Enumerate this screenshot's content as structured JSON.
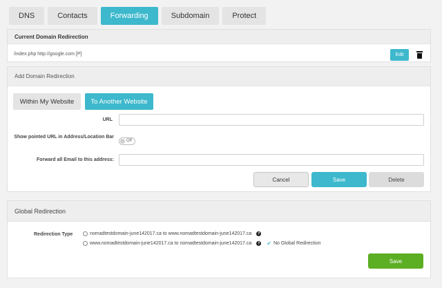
{
  "tabs": [
    {
      "label": "DNS",
      "active": false
    },
    {
      "label": "Contacts",
      "active": false
    },
    {
      "label": "Forwarding",
      "active": true
    },
    {
      "label": "Subdomain",
      "active": false
    },
    {
      "label": "Protect",
      "active": false
    }
  ],
  "current_redirection": {
    "title": "Current Domain Redirection",
    "entry": "/index.php http://google.com [P]",
    "edit_label": "Edit",
    "delete_icon": "trash-icon"
  },
  "add_redirection": {
    "title": "Add Domain Redirection",
    "mode_within": "Within My Website",
    "mode_another": "To Another Website",
    "active_mode": "To Another Website",
    "url_label": "URL",
    "url_value": "",
    "show_url_label": "Show pointed URL in Address/Location Bar",
    "show_url_toggle": "Off",
    "forward_email_label": "Forward all Email to this address:",
    "forward_email_value": "",
    "cancel_label": "Cancel",
    "save_label": "Save",
    "delete_label": "Delete"
  },
  "global_redirection": {
    "title": "Global Redirection",
    "type_label": "Redirection Type",
    "options": [
      "nomadtestdomain-june142017.ca to www.nomadtestdomain-june142017.ca",
      "www.nomadtestdomain-june142017.ca to nomadtestdomain-june142017.ca"
    ],
    "current_status": "No Global Redirection",
    "save_label": "Save"
  },
  "colors": {
    "accent": "#3db8cc",
    "save_green": "#5cae22"
  }
}
